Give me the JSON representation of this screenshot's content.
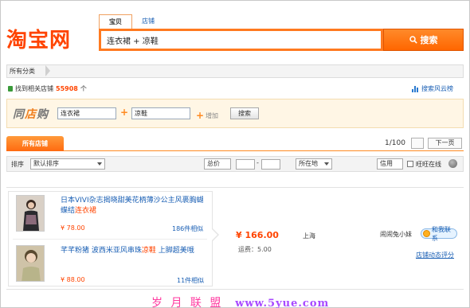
{
  "header": {
    "logo_text": "淘宝网",
    "tabs": [
      {
        "label": "宝贝",
        "active": true
      },
      {
        "label": "店铺",
        "active": false
      }
    ],
    "search_value": "连衣裙 + 凉鞋",
    "search_button": "搜索",
    "accent_color": "#ff6600"
  },
  "breadcrumb": {
    "label": "所有分类"
  },
  "result_summary": {
    "prefix": "找到相关店铺",
    "count": "55908",
    "suffix": "个",
    "cloud_link": "搜索风云榜"
  },
  "same_shop": {
    "logo_part1": "同",
    "logo_part2": "店",
    "logo_part3": "购",
    "keyword1": "连衣裙",
    "keyword2": "凉鞋",
    "add_label": "增加",
    "search_button": "搜索"
  },
  "shop_tabs": {
    "all_shops": "所有店铺",
    "pager_text": "1/100",
    "prev_button": "",
    "next_button": "下一页"
  },
  "sort_bar": {
    "sort_label": "排序",
    "sort_value": "默认排序",
    "total_label": "总价",
    "dash": "-",
    "location_label": "所在地",
    "credit_label": "信用",
    "online_label": "旺旺在线"
  },
  "results": [
    {
      "products": [
        {
          "title_prefix": "日本VIVI杂志揭晓甜美花柄薄沙公主风裹胸蝴蝶结",
          "title_highlight": "连衣裙",
          "title_suffix": "",
          "price": "¥ 78.00",
          "similar": "186件相似"
        },
        {
          "title_prefix": "芊芊粉猪 波西米亚风串珠",
          "title_highlight": "凉鞋",
          "title_suffix": " 上脚超美哦",
          "price": "¥ 88.00",
          "similar": "11件相似"
        }
      ],
      "price": "¥ 166.00",
      "shipping": "运费：5.00",
      "location": "上海",
      "shop_name": "闹闹兔小妹",
      "wangwang_label": "和我联系",
      "rating_link": "店铺动态评分"
    }
  ],
  "watermark": {
    "text": "岁 月 联 盟",
    "url": "www.5yue.com"
  }
}
